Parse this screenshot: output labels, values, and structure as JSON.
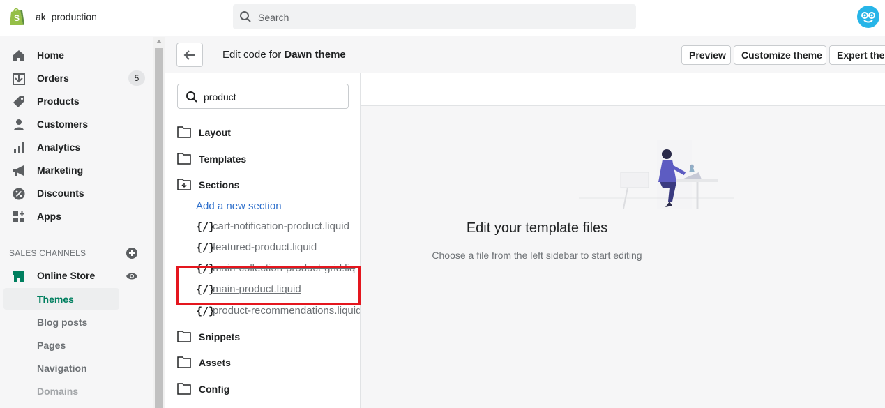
{
  "topbar": {
    "store_name": "ak_production",
    "search_placeholder": "Search"
  },
  "sidebar": {
    "items": [
      {
        "label": "Home",
        "icon": "home-icon"
      },
      {
        "label": "Orders",
        "icon": "orders-icon",
        "badge": "5"
      },
      {
        "label": "Products",
        "icon": "tag-icon"
      },
      {
        "label": "Customers",
        "icon": "person-icon"
      },
      {
        "label": "Analytics",
        "icon": "bar-chart-icon"
      },
      {
        "label": "Marketing",
        "icon": "megaphone-icon"
      },
      {
        "label": "Discounts",
        "icon": "discount-icon"
      },
      {
        "label": "Apps",
        "icon": "apps-icon"
      }
    ],
    "sales_channels_heading": "SALES CHANNELS",
    "online_store": "Online Store",
    "sub_items": [
      "Themes",
      "Blog posts",
      "Pages",
      "Navigation",
      "Domains"
    ]
  },
  "editor": {
    "title_prefix": "Edit code for",
    "theme_name": "Dawn theme",
    "buttons": {
      "preview": "Preview",
      "customize": "Customize theme",
      "expert": "Expert ther"
    },
    "file_search_value": "product",
    "folders": [
      "Layout",
      "Templates",
      "Sections",
      "Snippets",
      "Assets",
      "Config"
    ],
    "add_section": "Add a new section",
    "files": [
      "cart-notification-product.liquid",
      "featured-product.liquid",
      "main-collection-product-grid.liq",
      " main-product.liquid",
      "product-recommendations.liquid"
    ],
    "liquid_icon_glyph": "{/}",
    "empty_title": "Edit your template files",
    "empty_subtitle": "Choose a file from the left sidebar to start editing"
  },
  "colors": {
    "accent_green": "#007f5f",
    "link_blue": "#2c6ecb",
    "highlight_red": "#e4161e",
    "shopify_green": "#95bf47"
  }
}
